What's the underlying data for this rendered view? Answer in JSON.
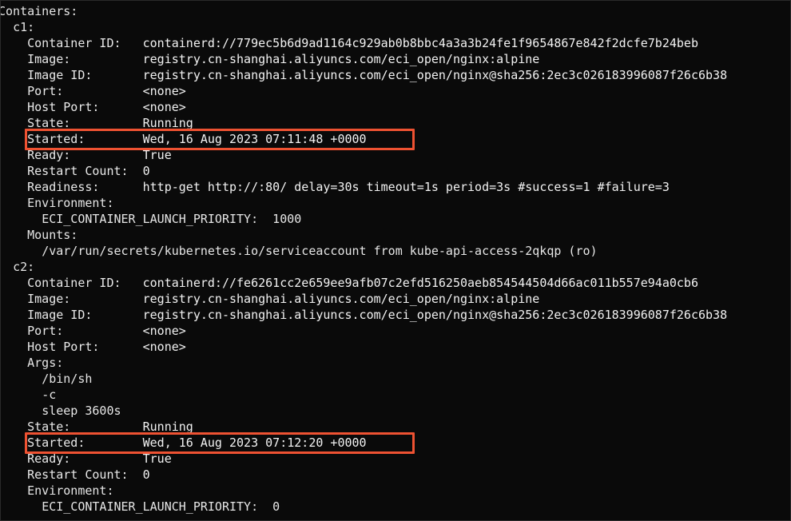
{
  "terminal": {
    "background": "#0a0a0a",
    "foreground": "#e6e6e6",
    "highlight_color": "#ee5232",
    "root_label": "Containers:"
  },
  "lines": [
    {
      "indent": 0,
      "text": "Containers:"
    },
    {
      "indent": 2,
      "text": "c1:"
    },
    {
      "indent": 4,
      "key": "Container ID:",
      "value": "containerd://779ec5b6d9ad1164c929ab0b8bbc4a3a3b24fe1f9654867e842f2dcfe7b24beb"
    },
    {
      "indent": 4,
      "key": "Image:",
      "value": "registry.cn-shanghai.aliyuncs.com/eci_open/nginx:alpine"
    },
    {
      "indent": 4,
      "key": "Image ID:",
      "value": "registry.cn-shanghai.aliyuncs.com/eci_open/nginx@sha256:2ec3c026183996087f26c6b38"
    },
    {
      "indent": 4,
      "key": "Port:",
      "value": "<none>"
    },
    {
      "indent": 4,
      "key": "Host Port:",
      "value": "<none>"
    },
    {
      "indent": 4,
      "key": "State:",
      "value": "Running"
    },
    {
      "indent": 4,
      "key": "Started:",
      "value": "Wed, 16 Aug 2023 07:11:48 +0000",
      "highlighted": true
    },
    {
      "indent": 4,
      "key": "Ready:",
      "value": "True"
    },
    {
      "indent": 4,
      "key": "Restart Count:",
      "value": "0"
    },
    {
      "indent": 4,
      "key": "Readiness:",
      "value": "http-get http://:80/ delay=30s timeout=1s period=3s #success=1 #failure=3"
    },
    {
      "indent": 4,
      "text": "Environment:"
    },
    {
      "indent": 6,
      "text": "ECI_CONTAINER_LAUNCH_PRIORITY:  1000"
    },
    {
      "indent": 4,
      "text": "Mounts:"
    },
    {
      "indent": 6,
      "text": "/var/run/secrets/kubernetes.io/serviceaccount from kube-api-access-2qkqp (ro)"
    },
    {
      "indent": 2,
      "text": "c2:"
    },
    {
      "indent": 4,
      "key": "Container ID:",
      "value": "containerd://fe6261cc2e659ee9afb07c2efd516250aeb854544504d66ac011b557e94a0cb6"
    },
    {
      "indent": 4,
      "key": "Image:",
      "value": "registry.cn-shanghai.aliyuncs.com/eci_open/nginx:alpine"
    },
    {
      "indent": 4,
      "key": "Image ID:",
      "value": "registry.cn-shanghai.aliyuncs.com/eci_open/nginx@sha256:2ec3c026183996087f26c6b38"
    },
    {
      "indent": 4,
      "key": "Port:",
      "value": "<none>"
    },
    {
      "indent": 4,
      "key": "Host Port:",
      "value": "<none>"
    },
    {
      "indent": 4,
      "text": "Args:"
    },
    {
      "indent": 6,
      "text": "/bin/sh"
    },
    {
      "indent": 6,
      "text": "-c"
    },
    {
      "indent": 6,
      "text": "sleep 3600s"
    },
    {
      "indent": 4,
      "key": "State:",
      "value": "Running"
    },
    {
      "indent": 4,
      "key": "Started:",
      "value": "Wed, 16 Aug 2023 07:12:20 +0000",
      "highlighted": true
    },
    {
      "indent": 4,
      "key": "Ready:",
      "value": "True"
    },
    {
      "indent": 4,
      "key": "Restart Count:",
      "value": "0"
    },
    {
      "indent": 4,
      "text": "Environment:"
    },
    {
      "indent": 6,
      "text": "ECI_CONTAINER_LAUNCH_PRIORITY:  0"
    }
  ],
  "containers": [
    {
      "name": "c1",
      "container_id": "containerd://779ec5b6d9ad1164c929ab0b8bbc4a3a3b24fe1f9654867e842f2dcfe7b24beb",
      "image": "registry.cn-shanghai.aliyuncs.com/eci_open/nginx:alpine",
      "image_id": "registry.cn-shanghai.aliyuncs.com/eci_open/nginx@sha256:2ec3c026183996087f26c6b38",
      "port": "<none>",
      "host_port": "<none>",
      "state": "Running",
      "started": "Wed, 16 Aug 2023 07:11:48 +0000",
      "ready": "True",
      "restart_count": "0",
      "readiness": "http-get http://:80/ delay=30s timeout=1s period=3s #success=1 #failure=3",
      "environment": {
        "ECI_CONTAINER_LAUNCH_PRIORITY": "1000"
      },
      "mounts": "/var/run/secrets/kubernetes.io/serviceaccount from kube-api-access-2qkqp (ro)"
    },
    {
      "name": "c2",
      "container_id": "containerd://fe6261cc2e659ee9afb07c2efd516250aeb854544504d66ac011b557e94a0cb6",
      "image": "registry.cn-shanghai.aliyuncs.com/eci_open/nginx:alpine",
      "image_id": "registry.cn-shanghai.aliyuncs.com/eci_open/nginx@sha256:2ec3c026183996087f26c6b38",
      "port": "<none>",
      "host_port": "<none>",
      "args": [
        "/bin/sh",
        "-c",
        "sleep 3600s"
      ],
      "state": "Running",
      "started": "Wed, 16 Aug 2023 07:12:20 +0000",
      "ready": "True",
      "restart_count": "0",
      "environment": {
        "ECI_CONTAINER_LAUNCH_PRIORITY": "0"
      }
    }
  ]
}
